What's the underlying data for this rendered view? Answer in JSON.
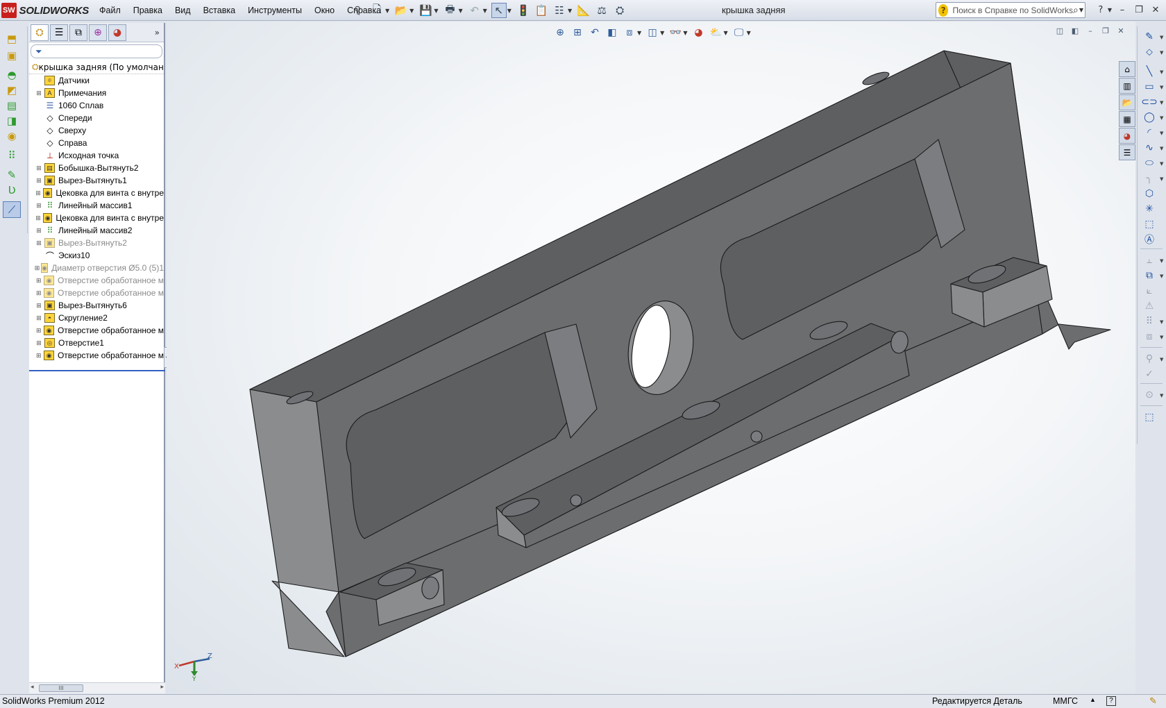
{
  "app": {
    "logo_badge": "SW",
    "logo_text": "SOLIDWORKS",
    "document_title": "крышка задняя"
  },
  "menu": [
    "Файл",
    "Правка",
    "Вид",
    "Вставка",
    "Инструменты",
    "Окно",
    "Справка"
  ],
  "help_search": {
    "placeholder": "Поиск в Справке по SolidWorks",
    "icon": "question-mark-icon"
  },
  "window_controls": [
    "minimize-icon",
    "restore-icon",
    "close-icon"
  ],
  "feature_tree": {
    "root": "крышка задняя  (По умолчанию<<По умолчанию>",
    "items": [
      {
        "label": "Датчики",
        "icon": "sensor-icon",
        "expand": false,
        "dim": false
      },
      {
        "label": "Примечания",
        "icon": "annotation-icon",
        "expand": true,
        "dim": false
      },
      {
        "label": "1060 Сплав",
        "icon": "material-icon",
        "expand": false,
        "dim": false
      },
      {
        "label": "Спереди",
        "icon": "plane-icon",
        "expand": false,
        "dim": false
      },
      {
        "label": "Сверху",
        "icon": "plane-icon",
        "expand": false,
        "dim": false
      },
      {
        "label": "Справа",
        "icon": "plane-icon",
        "expand": false,
        "dim": false
      },
      {
        "label": "Исходная точка",
        "icon": "origin-icon",
        "expand": false,
        "dim": false
      },
      {
        "label": "Бобышка-Вытянуть2",
        "icon": "extrude-boss-icon",
        "expand": true,
        "dim": false
      },
      {
        "label": "Вырез-Вытянуть1",
        "icon": "extrude-cut-icon",
        "expand": true,
        "dim": false
      },
      {
        "label": "Цековка для винта с внутре",
        "icon": "hole-wizard-icon",
        "expand": true,
        "dim": false
      },
      {
        "label": "Линейный массив1",
        "icon": "linear-pattern-icon",
        "expand": true,
        "dim": false
      },
      {
        "label": "Цековка для винта с внутре",
        "icon": "hole-wizard-icon",
        "expand": true,
        "dim": false
      },
      {
        "label": "Линейный массив2",
        "icon": "linear-pattern-icon",
        "expand": true,
        "dim": false
      },
      {
        "label": "Вырез-Вытянуть2",
        "icon": "extrude-cut-icon",
        "expand": true,
        "dim": true
      },
      {
        "label": "Эскиз10",
        "icon": "sketch-icon",
        "expand": false,
        "dim": false
      },
      {
        "label": "Диаметр отверстия Ø5.0 (5)1",
        "icon": "hole-wizard-icon",
        "expand": true,
        "dim": true
      },
      {
        "label": "Отверстие обработанное м",
        "icon": "hole-wizard-icon",
        "expand": true,
        "dim": true
      },
      {
        "label": "Отверстие обработанное м",
        "icon": "hole-wizard-icon",
        "expand": true,
        "dim": true
      },
      {
        "label": "Вырез-Вытянуть6",
        "icon": "extrude-cut-icon",
        "expand": true,
        "dim": false
      },
      {
        "label": "Скругление2",
        "icon": "fillet-icon",
        "expand": true,
        "dim": false
      },
      {
        "label": "Отверстие обработанное м",
        "icon": "hole-wizard-icon",
        "expand": true,
        "dim": false
      },
      {
        "label": "Отверстие1",
        "icon": "hole-icon",
        "expand": true,
        "dim": false
      },
      {
        "label": "Отверстие обработанное м",
        "icon": "hole-wizard-icon",
        "expand": true,
        "dim": false
      }
    ]
  },
  "triad": {
    "x": "X",
    "y": "Y",
    "z": "Z"
  },
  "statusbar": {
    "product": "SolidWorks Premium 2012",
    "status": "Редактируется Деталь",
    "units": "ММГС",
    "help": "?"
  },
  "colors": {
    "part_top": "#5e5f61",
    "part_front": "#6c6d6f",
    "part_side": "#8a8c8e",
    "part_inner": "#7b7d80",
    "accent": "#2f5d9b"
  }
}
